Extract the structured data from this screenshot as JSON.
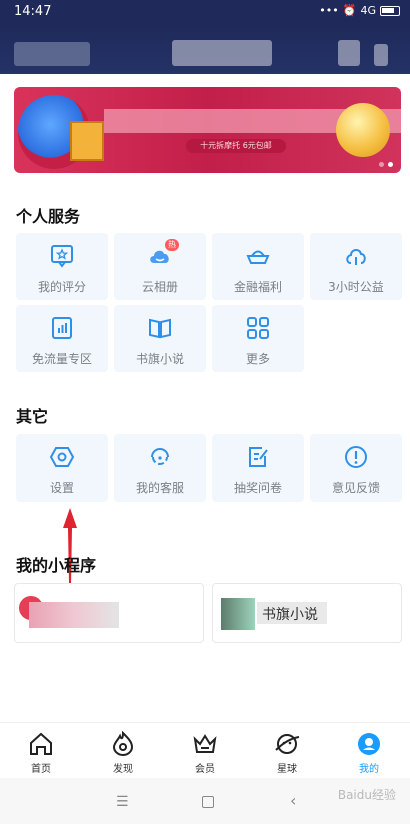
{
  "status_bar": {
    "time": "14:47",
    "signal_text": "4G"
  },
  "banner": {
    "subtitle": "十元拆摩托 6元包邮"
  },
  "sections": {
    "personal": {
      "title": "个人服务",
      "items": [
        {
          "label": "我的评分",
          "icon": "rating-icon"
        },
        {
          "label": "云相册",
          "icon": "cloud-album-icon",
          "badge": "热"
        },
        {
          "label": "金融福利",
          "icon": "ingot-icon"
        },
        {
          "label": "3小时公益",
          "icon": "charity-icon"
        },
        {
          "label": "免流量专区",
          "icon": "data-free-icon"
        },
        {
          "label": "书旗小说",
          "icon": "book-icon"
        },
        {
          "label": "更多",
          "icon": "more-grid-icon"
        }
      ]
    },
    "other": {
      "title": "其它",
      "items": [
        {
          "label": "设置",
          "icon": "settings-icon"
        },
        {
          "label": "我的客服",
          "icon": "customer-service-icon"
        },
        {
          "label": "抽奖问卷",
          "icon": "survey-icon"
        },
        {
          "label": "意见反馈",
          "icon": "feedback-icon"
        }
      ]
    },
    "mini_programs": {
      "title": "我的小程序",
      "items": [
        {
          "label": ""
        },
        {
          "label": "书旗小说"
        }
      ]
    }
  },
  "tabbar": [
    {
      "label": "首页",
      "icon": "home-icon"
    },
    {
      "label": "发现",
      "icon": "discover-icon"
    },
    {
      "label": "会员",
      "icon": "crown-icon"
    },
    {
      "label": "星球",
      "icon": "planet-icon"
    },
    {
      "label": "我的",
      "icon": "profile-icon",
      "active": true
    }
  ],
  "watermark": "Baidu经验",
  "colors": {
    "accent": "#1a9bff",
    "header_bg": "#1f2a5a",
    "tile_bg": "#f1f7fd",
    "banner_bg": "#c21f4a",
    "arrow": "#e0232e"
  }
}
